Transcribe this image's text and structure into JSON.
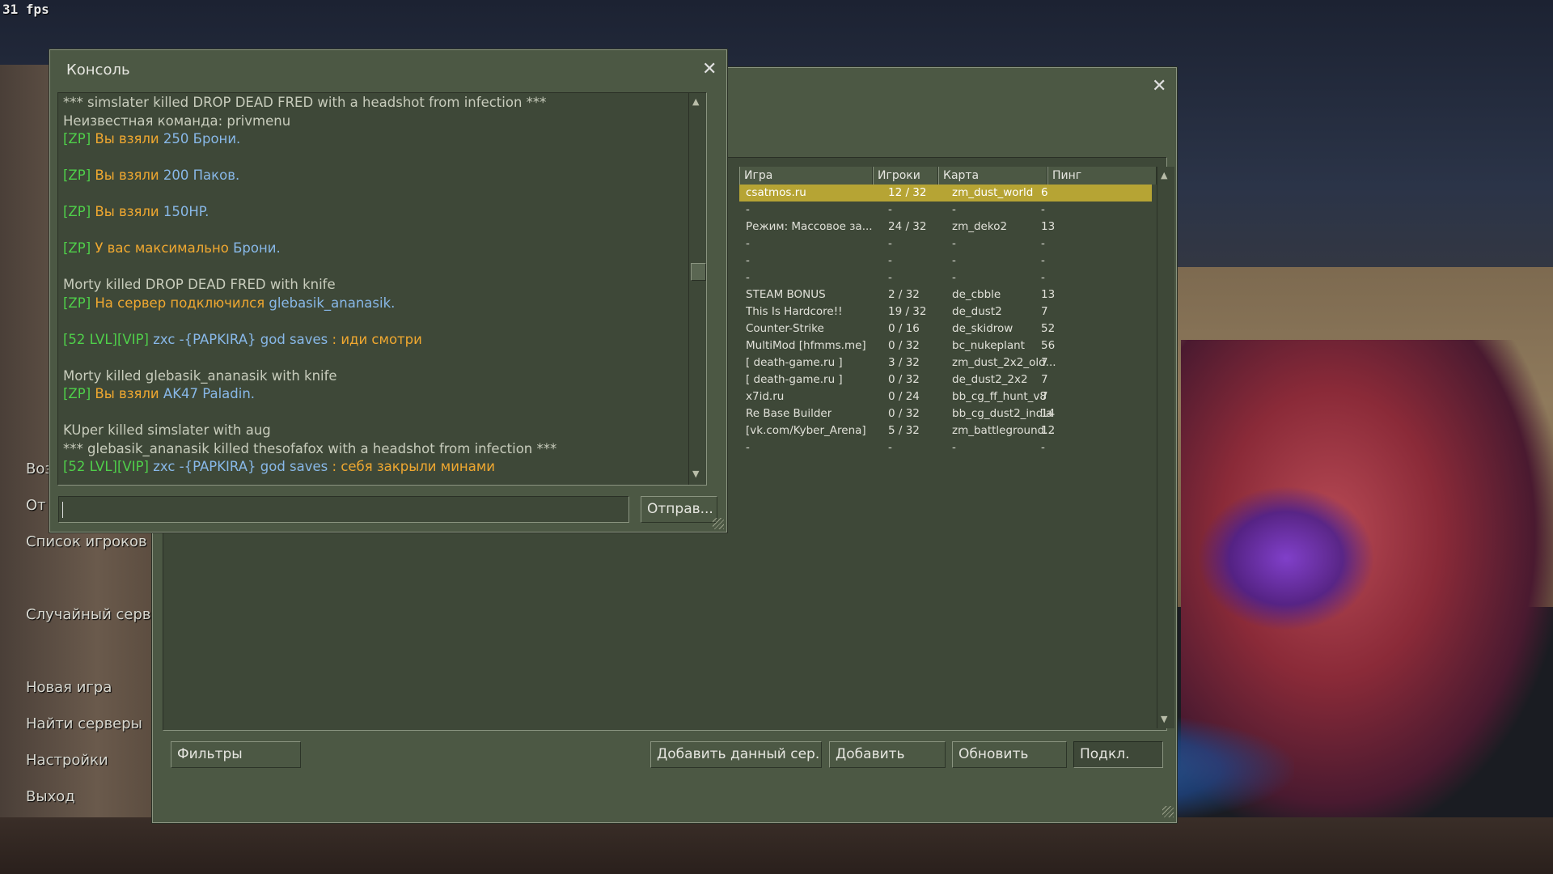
{
  "hud": {
    "fps": "31 fps"
  },
  "main_menu": {
    "items": [
      "Воз",
      "От",
      "Список игроков",
      "Случайный серв",
      "Новая игра",
      "Найти серверы",
      "Настройки",
      "Выход"
    ]
  },
  "console": {
    "title": "Консоль",
    "send_label": "Отправ...",
    "input_value": "",
    "lines": [
      [
        {
          "t": "*** simslater killed DROP DEAD FRED with a headshot from infection ***",
          "c": "w"
        }
      ],
      [
        {
          "t": "Неизвестная команда: privmenu",
          "c": "w"
        }
      ],
      [
        {
          "t": "[ZP] ",
          "c": "g"
        },
        {
          "t": "Вы взяли ",
          "c": "o"
        },
        {
          "t": "250 Брони.",
          "c": "b"
        }
      ],
      [],
      [
        {
          "t": "[ZP] ",
          "c": "g"
        },
        {
          "t": "Вы взяли ",
          "c": "o"
        },
        {
          "t": "200 Паков.",
          "c": "b"
        }
      ],
      [],
      [
        {
          "t": "[ZP] ",
          "c": "g"
        },
        {
          "t": "Вы взяли ",
          "c": "o"
        },
        {
          "t": "150HP.",
          "c": "b"
        }
      ],
      [],
      [
        {
          "t": "[ZP] ",
          "c": "g"
        },
        {
          "t": "У вас максимально ",
          "c": "o"
        },
        {
          "t": "Брони.",
          "c": "b"
        }
      ],
      [],
      [
        {
          "t": "Morty killed DROP DEAD FRED with knife",
          "c": "w"
        }
      ],
      [
        {
          "t": "[ZP] ",
          "c": "g"
        },
        {
          "t": "На сервер подключился ",
          "c": "o"
        },
        {
          "t": "glebasik_ananasik.",
          "c": "b"
        }
      ],
      [],
      [
        {
          "t": "[52 LVL][VIP] ",
          "c": "g"
        },
        {
          "t": "zxc -{PAPKIRA} god saves ",
          "c": "b"
        },
        {
          "t": ": иди смотри",
          "c": "o"
        }
      ],
      [],
      [
        {
          "t": "Morty killed glebasik_ananasik with knife",
          "c": "w"
        }
      ],
      [
        {
          "t": "[ZP] ",
          "c": "g"
        },
        {
          "t": "Вы взяли ",
          "c": "o"
        },
        {
          "t": "AK47 Paladin.",
          "c": "b"
        }
      ],
      [],
      [
        {
          "t": "KUper killed simslater with aug",
          "c": "w"
        }
      ],
      [
        {
          "t": "*** glebasik_ananasik killed thesofafox with a headshot from infection ***",
          "c": "w"
        }
      ],
      [
        {
          "t": "[52 LVL][VIP] ",
          "c": "g"
        },
        {
          "t": "zxc -{PAPKIRA} god saves ",
          "c": "b"
        },
        {
          "t": ": себя закрыли минами",
          "c": "o"
        }
      ]
    ]
  },
  "browser": {
    "columns": {
      "game": "Игра",
      "players": "Игроки",
      "map": "Карта",
      "ping": "Пинг"
    },
    "rows": [
      {
        "game": "csatmos.ru",
        "players": "12 / 32",
        "map": "zm_dust_world",
        "ping": "6",
        "selected": true
      },
      {
        "game": "-",
        "players": "-",
        "map": "-",
        "ping": "-"
      },
      {
        "game": "Режим: Массовое за...",
        "players": "24 / 32",
        "map": "zm_deko2",
        "ping": "13"
      },
      {
        "game": "-",
        "players": "-",
        "map": "-",
        "ping": "-"
      },
      {
        "game": "-",
        "players": "-",
        "map": "-",
        "ping": "-"
      },
      {
        "game": "-",
        "players": "-",
        "map": "-",
        "ping": "-"
      },
      {
        "game": "STEAM BONUS",
        "players": "2 / 32",
        "map": "de_cbble",
        "ping": "13"
      },
      {
        "game": "This Is Hardcore!!",
        "players": "19 / 32",
        "map": "de_dust2",
        "ping": "7"
      },
      {
        "game": "Counter-Strike",
        "players": "0 / 16",
        "map": "de_skidrow",
        "ping": "52"
      },
      {
        "game": "MultiMod [hfmms.me]",
        "players": "0 / 32",
        "map": "bc_nukeplant",
        "ping": "56"
      },
      {
        "game": "[ death-game.ru ]",
        "players": "3 / 32",
        "map": "zm_dust_2x2_old...",
        "ping": "7"
      },
      {
        "game": "[ death-game.ru ]",
        "players": "0 / 32",
        "map": "de_dust2_2x2",
        "ping": "7"
      },
      {
        "game": "x7id.ru",
        "players": "0 / 24",
        "map": "bb_cg_ff_hunt_v8",
        "ping": "7"
      },
      {
        "game": "Re Base Builder",
        "players": "0 / 32",
        "map": "bb_cg_dust2_india",
        "ping": "14"
      },
      {
        "game": "[vk.com/Kyber_Arena]",
        "players": "5 / 32",
        "map": "zm_battleground...",
        "ping": "12"
      },
      {
        "game": "-",
        "players": "-",
        "map": "-",
        "ping": "-"
      }
    ],
    "buttons": {
      "filters": "Фильтры",
      "add_current": "Добавить данный сер...",
      "add": "Добавить",
      "refresh": "Обновить",
      "connect": "Подкл."
    }
  }
}
